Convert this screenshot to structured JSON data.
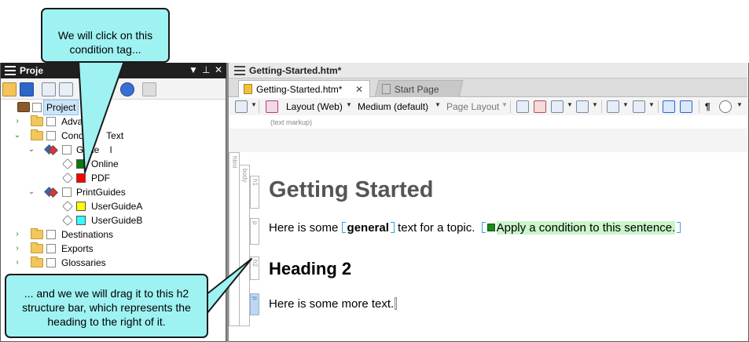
{
  "callouts": {
    "top": "We will click on this condition tag...",
    "bottom": "... and we we will drag it to this h2 structure bar, which represents the heading to the right of it."
  },
  "project_pane": {
    "title": "Project Organizer",
    "title_visible": "Proje",
    "controls": {
      "dropdown": "▼",
      "pin": "⊥",
      "close": "✕"
    },
    "tree": [
      {
        "id": "project",
        "label": "Project",
        "selected": true
      },
      {
        "id": "advanced",
        "label": "Advanc",
        "expanded": false
      },
      {
        "id": "conditional",
        "label": "Conditi      Text",
        "expanded": true
      },
      {
        "id": "general",
        "label": "Gene    l",
        "expanded": true
      },
      {
        "id": "online",
        "label": "Online",
        "color": "#0a7a0a"
      },
      {
        "id": "pdf",
        "label": "PDF",
        "color": "#ff0000"
      },
      {
        "id": "printguides",
        "label": "PrintGuides",
        "expanded": true
      },
      {
        "id": "userguidea",
        "label": "UserGuideA",
        "color": "#ffff00"
      },
      {
        "id": "userguideb",
        "label": "UserGuideB",
        "color": "#33ffff"
      },
      {
        "id": "destinations",
        "label": "Destinations",
        "expanded": false
      },
      {
        "id": "exports",
        "label": "Exports",
        "expanded": false
      },
      {
        "id": "glossaries",
        "label": "Glossaries",
        "expanded": false
      }
    ]
  },
  "editor": {
    "title": "Getting-Started.htm*",
    "tabs": [
      {
        "label": "Getting-Started.htm*",
        "active": true,
        "close": "✕"
      },
      {
        "label": "Start Page",
        "active": false
      }
    ],
    "toolbar": {
      "layout": "Layout (Web)",
      "medium": "Medium (default)",
      "page_layout": "Page Layout",
      "pilcrow": "¶"
    },
    "markup_note": "(text markup)",
    "structure": {
      "html": "html",
      "body": "body",
      "h1": "h1",
      "p1": "p",
      "h2": "h2",
      "p2": "p"
    },
    "document": {
      "heading1": "Getting Started",
      "para1_before": "Here is some ",
      "para1_bold": "general",
      "para1_after": " text for a topic.",
      "para1_conditioned": "Apply a condition to this sentence.",
      "heading2": "Heading 2",
      "para2": "Here is some more text."
    }
  },
  "colors": {
    "callout_fill": "#9ff2f2",
    "condition_online": "#0a7a0a",
    "condition_highlight": "#c9f5c9",
    "h2_bar_highlight": "#bcd8f0"
  }
}
